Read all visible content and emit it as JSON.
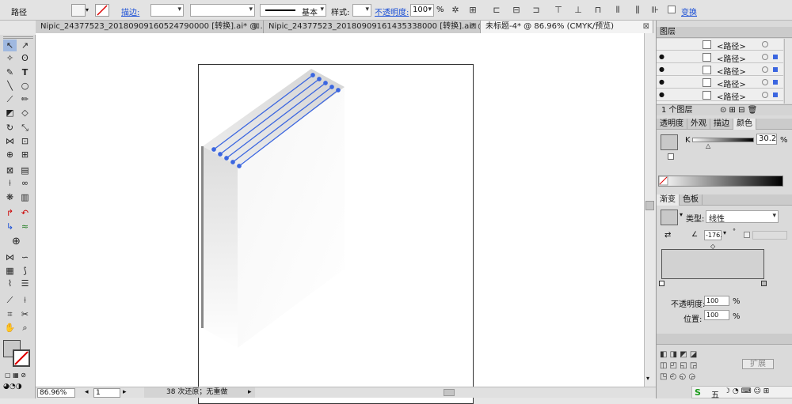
{
  "control_bar": {
    "object_type": "路径",
    "stroke_label": "描边:",
    "style_label": "样式:",
    "brush_value": "基本",
    "opacity_label": "不透明度:",
    "opacity_value": "100",
    "opacity_unit": "%",
    "transform_label": "变换"
  },
  "tabs": [
    {
      "label": "Nipic_24377523_20180909160524790000 [转换].ai* @ ...",
      "close": "⊠"
    },
    {
      "label": "Nipic_24377523_20180909161435338000 [转换].ai* @ ...",
      "close": "⊠"
    },
    {
      "label": "未标题-4* @ 86.96% (CMYK/预览)",
      "close": "⊠"
    }
  ],
  "layers_panel": {
    "title": "图层",
    "rows": [
      "<路径>",
      "<路径>",
      "<路径>",
      "<路径>",
      "<路径>"
    ],
    "footer": "1 个图层"
  },
  "color_panel": {
    "tabs": [
      "透明度",
      "外观",
      "描边",
      "颜色"
    ],
    "channel_label": "K",
    "k_value": "30.2",
    "unit": "%"
  },
  "gradient_panel": {
    "tabs": [
      "渐变",
      "色板"
    ],
    "type_label": "类型:",
    "type_value": "线性",
    "angle_value": "-176.",
    "angle_unit": "°",
    "opacity_label": "不透明度:",
    "opacity_value": "100",
    "position_label": "位置:",
    "position_value": "100",
    "unit": "%"
  },
  "bottom_panel": {
    "expand_label": "扩展",
    "ime_label": "五"
  },
  "status_bar": {
    "zoom": "86.96%",
    "page": "1",
    "history": "38 次还原；无重做"
  },
  "colors": {
    "accent_blue": "#3b66e0",
    "selection_blue": "#1a4fd6",
    "gray_swatch": "#c8c8c8"
  }
}
